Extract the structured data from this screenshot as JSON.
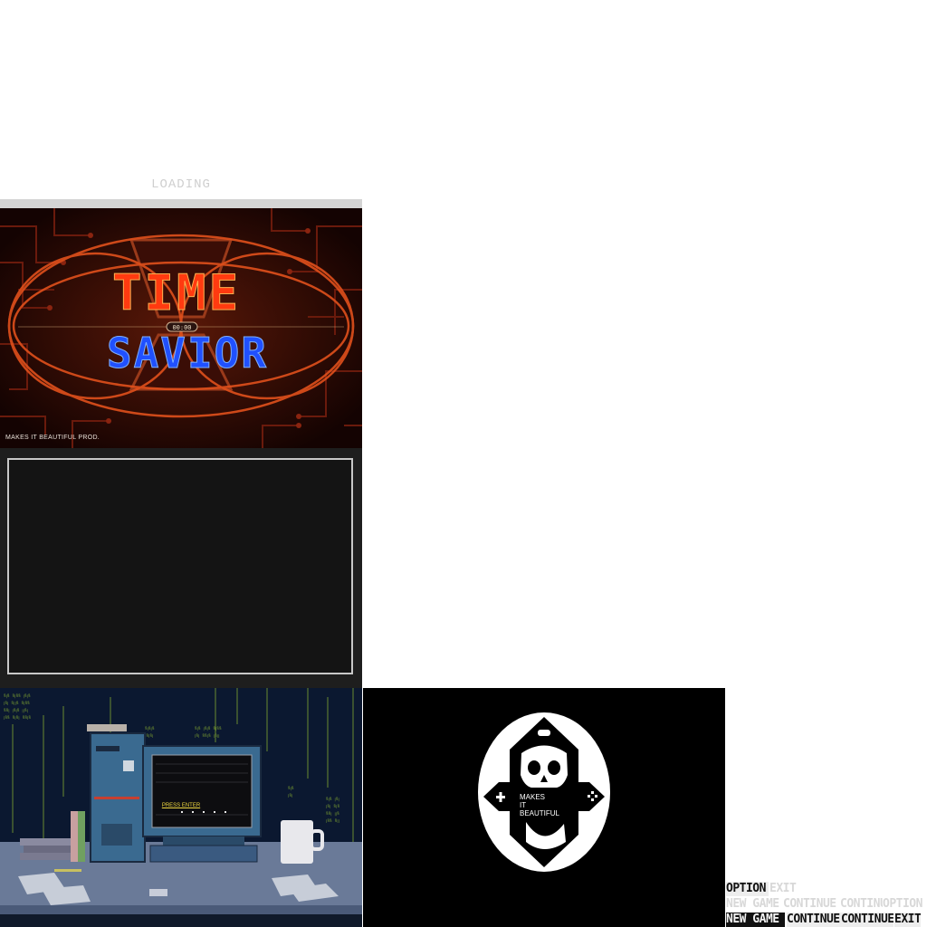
{
  "loading": {
    "label": "LOADING"
  },
  "title_screen": {
    "title_line1": "TIME",
    "title_line2": "SAVIOR",
    "timer": "00:00",
    "credit": "MAKES IT BEAUTIFUL PROD."
  },
  "desk_scene": {
    "monitor_text": "PRESS ENTER"
  },
  "logo": {
    "text": [
      "MAKES",
      "IT",
      "BEAUTIFUL"
    ]
  },
  "menu_sprites": {
    "row1": [
      "OPTION",
      "EXIT"
    ],
    "row2": [
      "NEW GAME",
      "CONTINUE",
      "CONTINUE",
      "OPTION"
    ],
    "row3": [
      "NEW GAME",
      "CONTINUE",
      "CONTINUE",
      "EXIT"
    ]
  },
  "colors": {
    "title_red": "#ff3a10",
    "title_blue": "#2050ff",
    "monitor_text": "#f0d840",
    "loading_bar": "#d4d4d4"
  }
}
